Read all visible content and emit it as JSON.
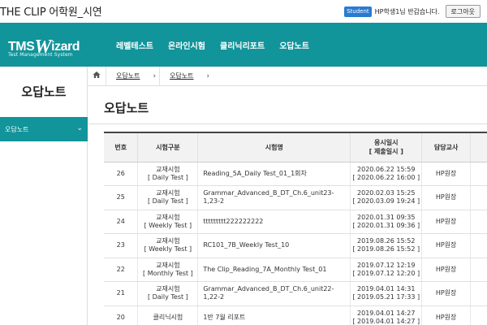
{
  "topbar": {
    "site_title": "THE CLIP 어학원_시연",
    "badge": "Student",
    "greeting": "HP학생1님 반갑습니다.",
    "logout_label": "로그아웃"
  },
  "logo": {
    "main_prefix": "TMS",
    "main_w": "W",
    "main_suffix": "izard",
    "sub": "Test Management System"
  },
  "nav": {
    "items": [
      "레벨테스트",
      "온라인시험",
      "클리닉리포트",
      "오답노트"
    ]
  },
  "sidebar": {
    "title": "오답노트",
    "active_item": "오답노트",
    "chevron": "⌄"
  },
  "breadcrumb": {
    "home_icon": "home-icon",
    "items": [
      "오답노트",
      "오답노트"
    ]
  },
  "page_title": "오답노트",
  "table": {
    "headers": {
      "no": "번호",
      "type": "시험구분",
      "name": "시험명",
      "date_line1": "응시일시",
      "date_line2": "[ 제출일시 ]",
      "teacher": "담당교사"
    },
    "rows": [
      {
        "no": "26",
        "type1": "교재시험",
        "type2": "[ Daily Test ]",
        "name": "Reading_5A_Daily Test_01_1회차",
        "date1": "2020.06.22 15:59",
        "date2": "[ 2020.06.22 16:00 ]",
        "teacher": "HP원장"
      },
      {
        "no": "25",
        "type1": "교재시험",
        "type2": "[ Daily Test ]",
        "name": "Grammar_Advanced_B_DT_Ch.6_unit23-1,23-2",
        "date1": "2020.02.03 15:25",
        "date2": "[ 2020.03.09 19:24 ]",
        "teacher": "HP원장"
      },
      {
        "no": "24",
        "type1": "교재시험",
        "type2": "[ Weekly Test ]",
        "name": "ttttttttt222222222",
        "date1": "2020.01.31 09:35",
        "date2": "[ 2020.01.31 09:36 ]",
        "teacher": "HP원장"
      },
      {
        "no": "23",
        "type1": "교재시험",
        "type2": "[ Weekly Test ]",
        "name": "RC101_7B_Weekly Test_10",
        "date1": "2019.08.26 15:52",
        "date2": "[ 2019.08.26 15:52 ]",
        "teacher": "HP원장"
      },
      {
        "no": "22",
        "type1": "교재시험",
        "type2": "[ Monthly Test ]",
        "name": "The Clip_Reading_7A_Monthly Test_01",
        "date1": "2019.07.12 12:19",
        "date2": "[ 2019.07.12 12:20 ]",
        "teacher": "HP원장"
      },
      {
        "no": "21",
        "type1": "교재시험",
        "type2": "[ Daily Test ]",
        "name": "Grammar_Advanced_B_DT_Ch.6_unit22-1,22-2",
        "date1": "2019.04.01 14:31",
        "date2": "[ 2019.05.21 17:33 ]",
        "teacher": "HP원장"
      },
      {
        "no": "20",
        "type1": "클리닉시험",
        "type2": "",
        "name": "1반 7월 리포트",
        "date1": "2019.04.01 14:27",
        "date2": "[ 2019.04.01 14:27 ]",
        "teacher": "HP원장"
      }
    ]
  },
  "colors": {
    "brand_teal": "#11949a",
    "badge_blue": "#2a7bd0"
  }
}
